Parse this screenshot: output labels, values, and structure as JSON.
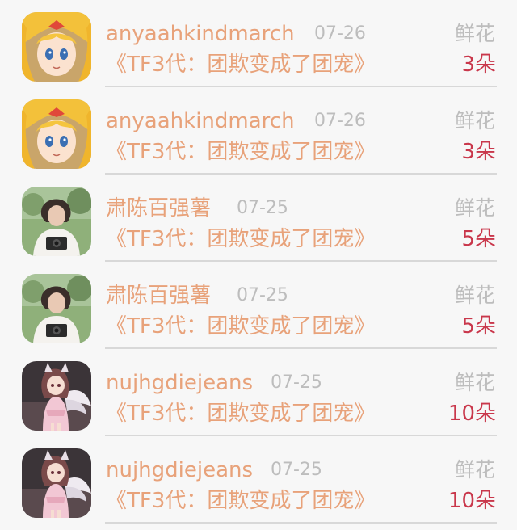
{
  "rows": [
    {
      "username": "anyaahkindmarch",
      "date": "07-26",
      "title": "《TF3代：团欺变成了团宠》",
      "gift_type": "鲜花",
      "gift_count": "3朵",
      "avatar": "anime-blonde-girl"
    },
    {
      "username": "anyaahkindmarch",
      "date": "07-26",
      "title": "《TF3代：团欺变成了团宠》",
      "gift_type": "鲜花",
      "gift_count": "3朵",
      "avatar": "anime-blonde-girl"
    },
    {
      "username": "肃陈百强薯",
      "date": "07-25",
      "title": "《TF3代：团欺变成了团宠》",
      "gift_type": "鲜花",
      "gift_count": "5朵",
      "avatar": "photo-woman-camera"
    },
    {
      "username": "肃陈百强薯",
      "date": "07-25",
      "title": "《TF3代：团欺变成了团宠》",
      "gift_type": "鲜花",
      "gift_count": "5朵",
      "avatar": "photo-woman-camera"
    },
    {
      "username": "nujhgdiejeans",
      "date": "07-25",
      "title": "《TF3代：团欺变成了团宠》",
      "gift_type": "鲜花",
      "gift_count": "10朵",
      "avatar": "anime-winged-girl"
    },
    {
      "username": "nujhgdiejeans",
      "date": "07-25",
      "title": "《TF3代：团欺变成了团宠》",
      "gift_type": "鲜花",
      "gift_count": "10朵",
      "avatar": "anime-winged-girl"
    }
  ]
}
